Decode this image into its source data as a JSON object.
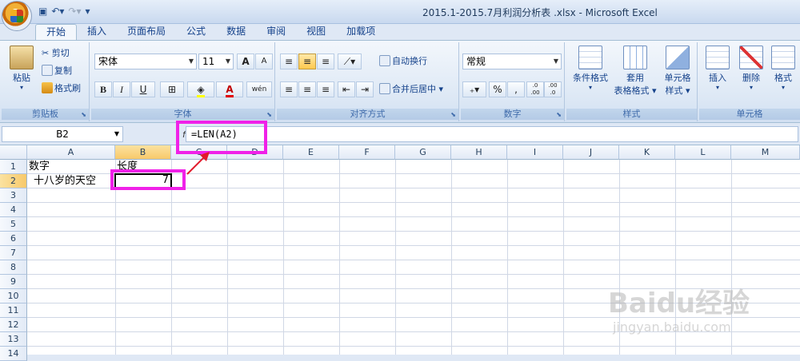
{
  "window": {
    "title": "2015.1-2015.7月利润分析表 .xlsx - Microsoft Excel",
    "qat": [
      "save-icon",
      "undo-icon",
      "redo-icon",
      "customize-icon"
    ]
  },
  "tabs": [
    "开始",
    "插入",
    "页面布局",
    "公式",
    "数据",
    "审阅",
    "视图",
    "加载项"
  ],
  "active_tab": "开始",
  "ribbon": {
    "clipboard": {
      "label": "剪贴板",
      "paste": "粘贴",
      "cut": "剪切",
      "copy": "复制",
      "format_painter": "格式刷"
    },
    "font": {
      "label": "字体",
      "name": "宋体",
      "size": "11",
      "bold": "B",
      "italic": "I",
      "underline": "U",
      "grow": "A",
      "shrink": "A",
      "phonetic": "wén"
    },
    "alignment": {
      "label": "对齐方式",
      "wrap": "自动换行",
      "merge": "合并后居中"
    },
    "number": {
      "label": "数字",
      "format": "常规",
      "percent": "%",
      "comma": ",",
      "inc_dec": ".0 .00",
      "dec_dec": ".00 .0"
    },
    "styles": {
      "label": "样式",
      "conditional": "条件格式",
      "table_line1": "套用",
      "table_line2": "表格格式",
      "cell_line1": "单元格",
      "cell_line2": "样式"
    },
    "cells": {
      "label": "单元格",
      "insert": "插入",
      "delete": "删除",
      "format": "格式"
    }
  },
  "formula_bar": {
    "name_box": "B2",
    "fx": "fx",
    "formula": "=LEN(A2)"
  },
  "columns": [
    "A",
    "B",
    "C",
    "D",
    "E",
    "F",
    "G",
    "H",
    "I",
    "J",
    "K",
    "L",
    "M"
  ],
  "rows": [
    "1",
    "2",
    "3",
    "4",
    "5",
    "6",
    "7",
    "8",
    "9",
    "10",
    "11",
    "12",
    "13",
    "14"
  ],
  "cells": {
    "A1": "数字",
    "B1": "长度",
    "A2": "十八岁的天空",
    "B2": "7"
  },
  "watermark": {
    "main": "Baidu经验",
    "sub": "jingyan.baidu.com"
  },
  "colors": {
    "highlight": "#f021e8",
    "arrow": "#e11a2b",
    "selected_header": "#f8c96a"
  }
}
